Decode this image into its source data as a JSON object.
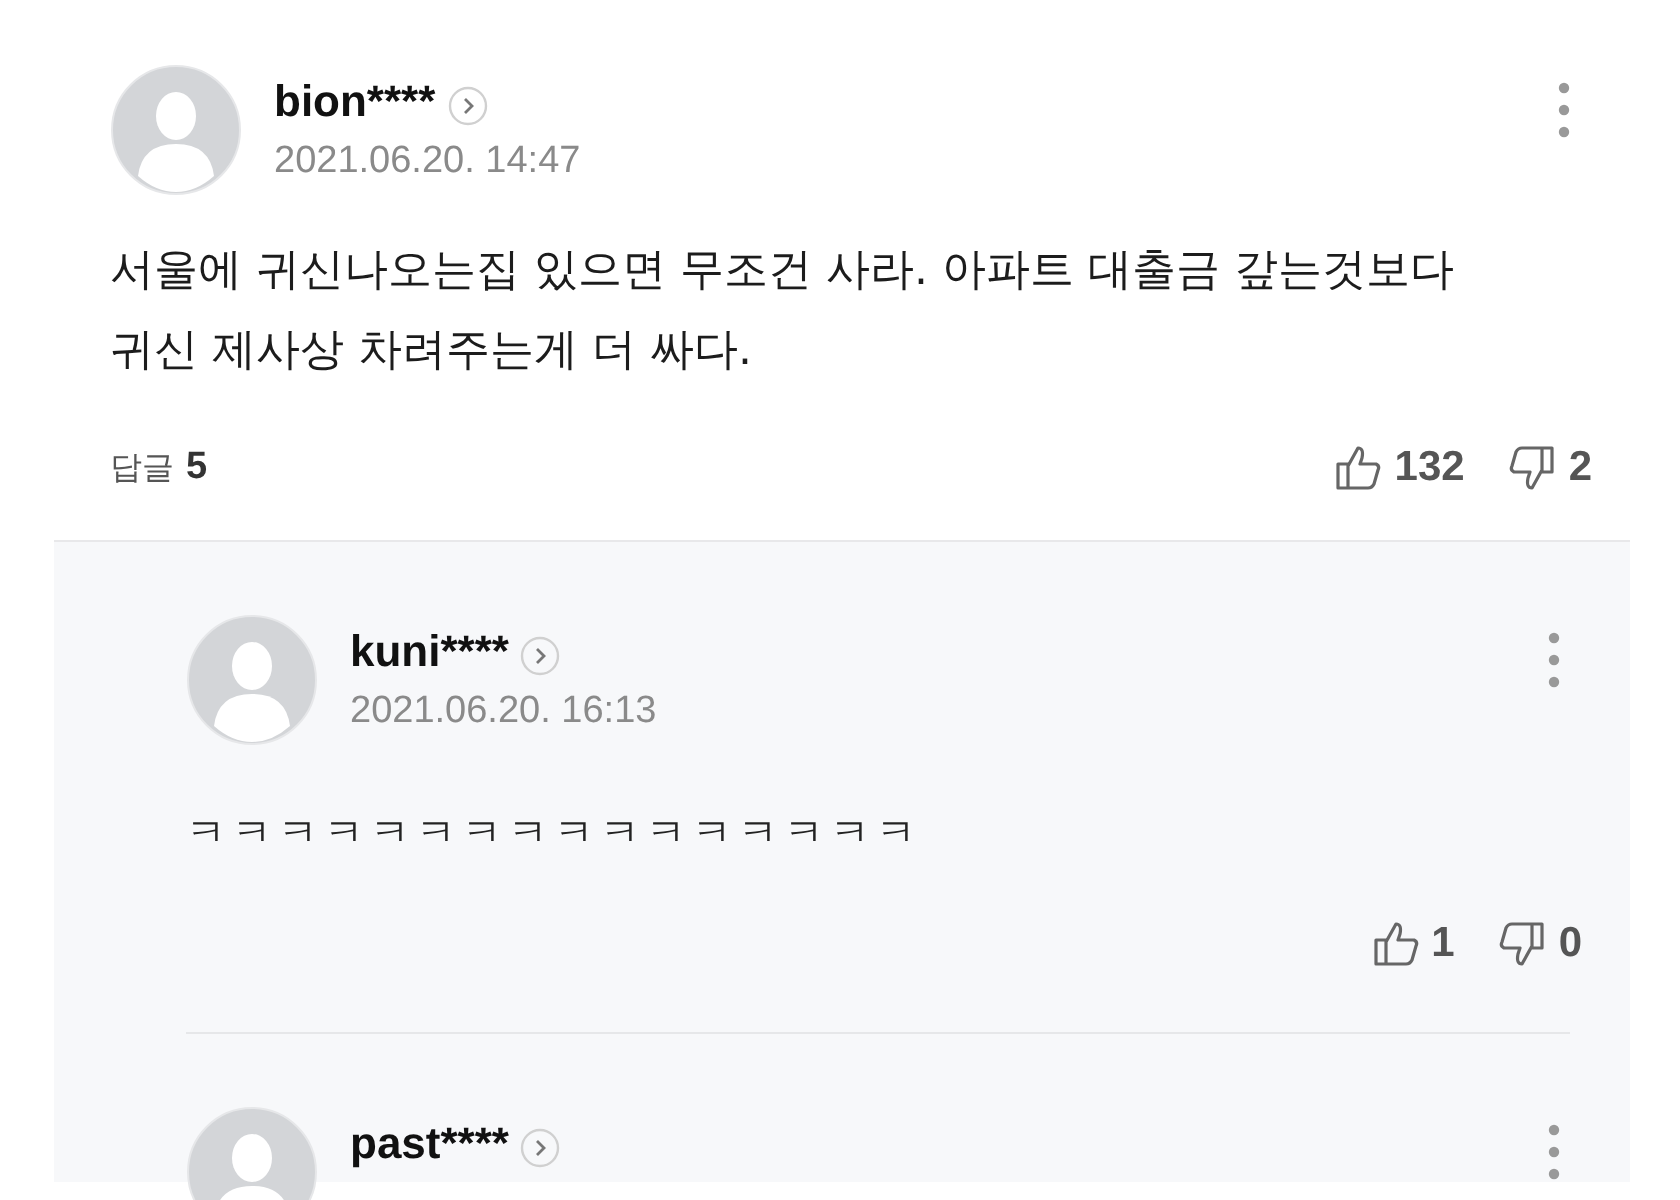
{
  "comment": {
    "author": "bion****",
    "date": "2021.06.20. 14:47",
    "text": "서울에 귀신나오는집 있으면 무조건 사라. 아파트 대출금 갚는것보다 귀신 제사상 차려주는게 더 싸다.",
    "replies_label": "답글",
    "replies_count": "5",
    "likes": "132",
    "dislikes": "2"
  },
  "replies": [
    {
      "author": "kuni****",
      "date": "2021.06.20. 16:13",
      "text": "ㅋㅋㅋㅋㅋㅋㅋㅋㅋㅋㅋㅋㅋㅋㅋㅋ",
      "likes": "1",
      "dislikes": "0"
    },
    {
      "author": "past****"
    }
  ]
}
